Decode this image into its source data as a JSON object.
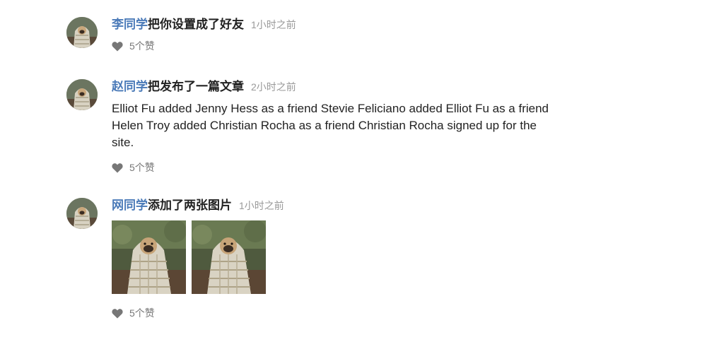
{
  "feed": {
    "events": [
      {
        "user": "李同学",
        "action": "把你设置成了好友",
        "date": "1小时之前",
        "likes": "5个赞"
      },
      {
        "user": "赵同学",
        "action": "把发布了一篇文章",
        "date": "2小时之前",
        "text": "Elliot Fu added Jenny Hess as a friend Stevie Feliciano added Elliot Fu as a friend Helen Troy added Christian Rocha as a friend Christian Rocha signed up for the site.",
        "likes": "5个赞"
      },
      {
        "user": "网同学",
        "action": "添加了两张图片",
        "date": "1小时之前",
        "images": [
          "pug-in-blanket-photo",
          "pug-in-blanket-photo"
        ],
        "likes": "5个赞"
      }
    ]
  },
  "icons": {
    "like": "heart-icon"
  },
  "colors": {
    "user_link": "#4a7ab8",
    "text": "#222222",
    "muted": "#999999",
    "like_icon": "#777777"
  }
}
